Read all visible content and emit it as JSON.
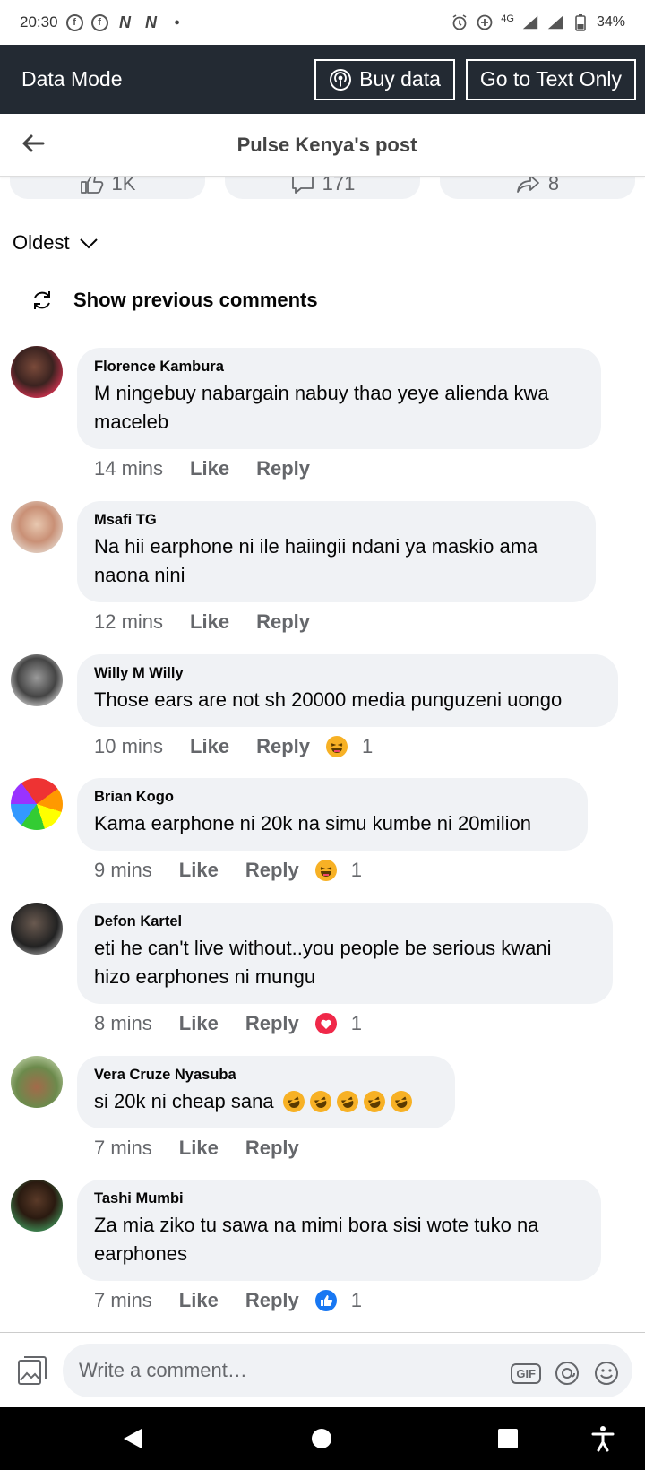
{
  "status_bar": {
    "time": "20:30",
    "network": "4G",
    "battery": "34%"
  },
  "data_mode": {
    "label": "Data Mode",
    "buy_data": "Buy data",
    "text_only": "Go to Text Only"
  },
  "header": {
    "title": "Pulse Kenya's post"
  },
  "reactions": {
    "likes": "1K",
    "comments": "171",
    "shares": "8"
  },
  "sort": {
    "label": "Oldest"
  },
  "show_previous": "Show previous comments",
  "comments": [
    {
      "name": "Florence Kambura",
      "text_lines": [
        "M ningebuy nabargain nabuy thao yeye alienda kwa",
        "maceleb"
      ],
      "time": "14 mins",
      "like": "Like",
      "reply": "Reply",
      "reaction_count": ""
    },
    {
      "name": "Msafi TG",
      "text_lines": [
        "Na hii earphone ni ile haiingii ndani ya maskio ama",
        "naona nini"
      ],
      "time": "12 mins",
      "like": "Like",
      "reply": "Reply",
      "reaction_count": ""
    },
    {
      "name": "Willy M Willy",
      "text_lines": [
        "Those ears are not sh 20000 media punguzeni uongo"
      ],
      "time": "10 mins",
      "like": "Like",
      "reply": "Reply",
      "reaction_count": "1",
      "reaction": "haha"
    },
    {
      "name": "Brian Kogo",
      "text_lines": [
        "Kama earphone ni 20k na simu kumbe ni 20milion"
      ],
      "time": "9 mins",
      "like": "Like",
      "reply": "Reply",
      "reaction_count": "1",
      "reaction": "haha"
    },
    {
      "name": "Defon Kartel",
      "text_lines": [
        "eti he can't live without..you people be serious kwani",
        "hizo earphones ni mungu"
      ],
      "time": "8 mins",
      "like": "Like",
      "reply": "Reply",
      "reaction_count": "1",
      "reaction": "love"
    },
    {
      "name": "Vera Cruze Nyasuba",
      "text_lines": [
        "si 20k ni cheap sana"
      ],
      "time": "7 mins",
      "like": "Like",
      "reply": "Reply",
      "reaction_count": ""
    },
    {
      "name": "Tashi Mumbi",
      "text_lines": [
        "Za mia ziko tu sawa na mimi bora sisi wote tuko na",
        "earphones"
      ],
      "time": "7 mins",
      "like": "Like",
      "reply": "Reply",
      "reaction_count": "1",
      "reaction": "like"
    }
  ],
  "composer": {
    "placeholder": "Write a comment…",
    "gif": "GIF"
  },
  "colors": {
    "data_bar": "#232a33",
    "bubble": "#f0f2f5",
    "meta": "#65676b",
    "like_blue": "#1877f2",
    "love_red": "#f02849",
    "haha_yellow": "#f7b125"
  }
}
